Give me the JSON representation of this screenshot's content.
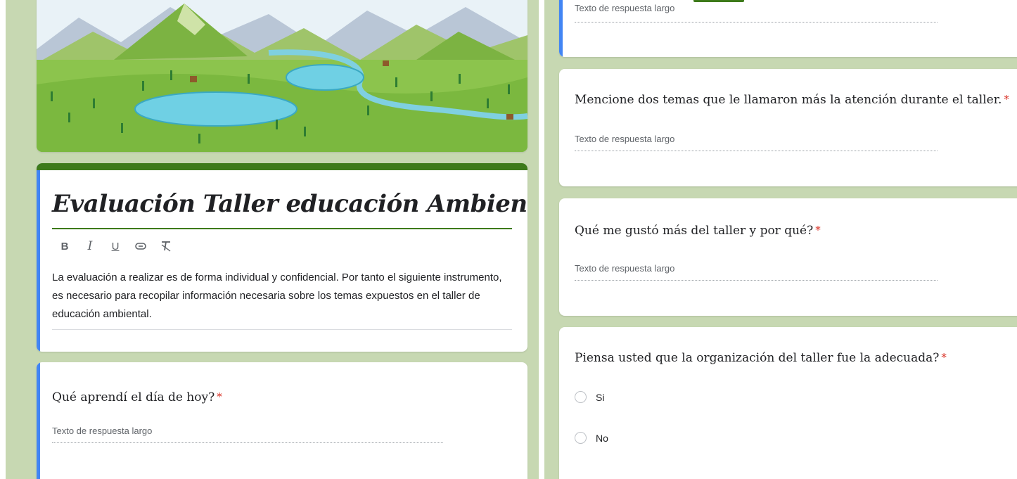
{
  "form": {
    "title": "Evaluación Taller educación Ambiental.",
    "description": "La evaluación a realizar es de forma individual y confidencial.  Por tanto el siguiente instrumento, es necesario para recopilar información necesaria sobre los temas  expuestos en el taller de educación ambiental.",
    "toolbar": {
      "bold": "B",
      "italic": "I",
      "underline": "U",
      "link_icon": "link-icon",
      "clear_format_icon": "clear-format-icon"
    }
  },
  "theme": {
    "header_color": "#3d7a1a",
    "background_color": "#c7d8b2",
    "active_card_accent": "#4285f4",
    "required_color": "#d93025"
  },
  "questions": [
    {
      "title": "Qué aprendí el día de hoy?",
      "required": "*",
      "placeholder": "Texto de respuesta largo"
    },
    {
      "title": "Mencione dos temas que le llamaron más la atención durante el taller.",
      "required": "*",
      "placeholder": "Texto de respuesta largo"
    },
    {
      "title": "Qué me gustó más del taller y por qué?",
      "required": "*",
      "placeholder": "Texto de respuesta largo"
    },
    {
      "title": "Piensa usted que la organización del taller fue la adecuada?",
      "required": "*",
      "options": [
        "Si",
        "No"
      ]
    }
  ],
  "partial_top": {
    "placeholder": "Texto de respuesta largo"
  }
}
